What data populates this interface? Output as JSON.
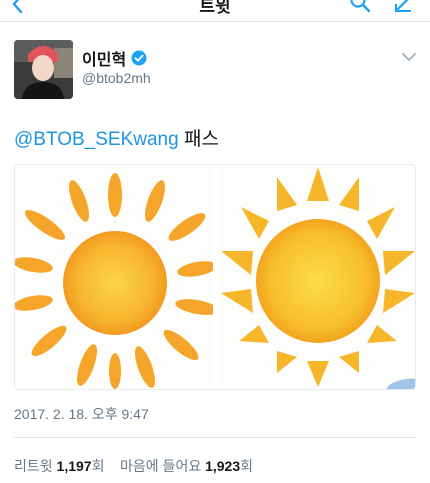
{
  "header": {
    "title": "트윗",
    "back_icon": "back-arrow-icon",
    "search_icon": "search-icon",
    "compose_icon": "compose-icon"
  },
  "author": {
    "name": "이민혁",
    "handle": "@btob2mh",
    "verified": true,
    "accent_color": "#1da1f2"
  },
  "tweet": {
    "mention": "@BTOB_SEKwang",
    "text": " 패스",
    "timestamp": "2017. 2. 18. 오후 9:47"
  },
  "stats": {
    "retweet_label": "리트윗",
    "retweet_count": "1,197",
    "retweet_unit": "회",
    "like_label": "마음에 들어요",
    "like_count": "1,923",
    "like_unit": "회"
  }
}
